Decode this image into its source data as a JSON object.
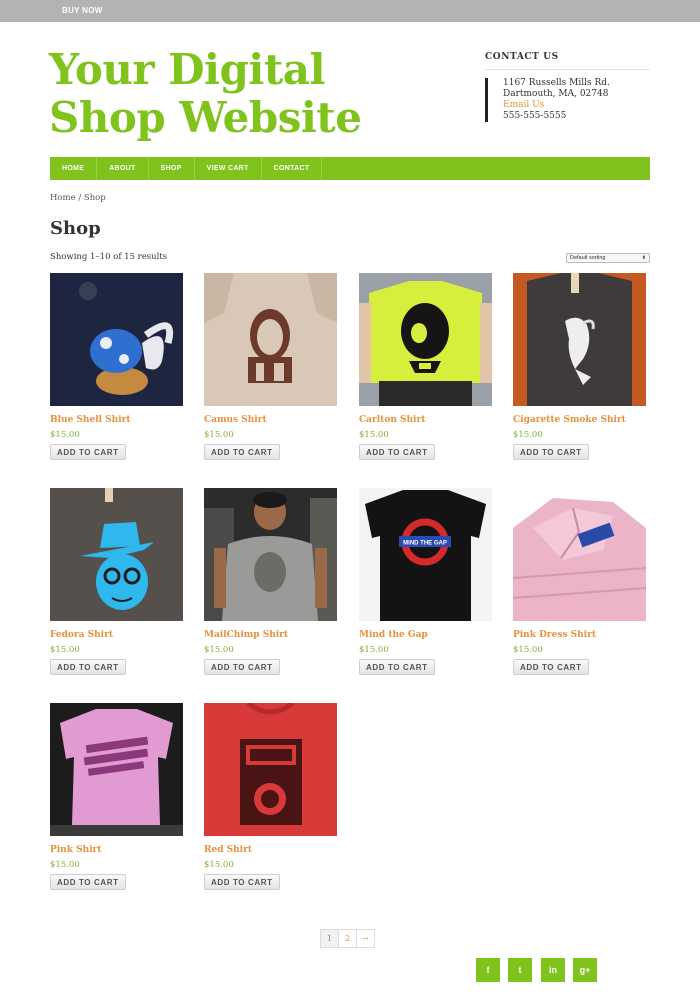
{
  "topbar": {
    "buy_now": "BUY NOW"
  },
  "site": {
    "title": "Your Digital Shop Website"
  },
  "contact": {
    "heading": "CONTACT US",
    "address1": "1167 Russells Mills Rd.",
    "address2": "Dartmouth, MA, 02748",
    "email_label": "Email Us",
    "phone": "555-555-5555"
  },
  "nav": [
    "HOME",
    "ABOUT",
    "SHOP",
    "VIEW CART",
    "CONTACT"
  ],
  "breadcrumb": "Home / Shop",
  "page": {
    "title": "Shop",
    "result_count": "Showing 1–10 of 15 results",
    "sort_selected": "Default sorting"
  },
  "products": [
    {
      "name": "Blue Shell Shirt",
      "price": "$15.00",
      "button": "ADD TO CART"
    },
    {
      "name": "Camus Shirt",
      "price": "$15.00",
      "button": "ADD TO CART"
    },
    {
      "name": "Carlton Shirt",
      "price": "$15.00",
      "button": "ADD TO CART"
    },
    {
      "name": "Cigarette Smoke Shirt",
      "price": "$15.00",
      "button": "ADD TO CART"
    },
    {
      "name": "Fedora Shirt",
      "price": "$15.00",
      "button": "ADD TO CART"
    },
    {
      "name": "MailChimp Shirt",
      "price": "$15.00",
      "button": "ADD TO CART"
    },
    {
      "name": "Mind the Gap",
      "price": "$15.00",
      "button": "ADD TO CART"
    },
    {
      "name": "Pink Dress Shirt",
      "price": "$15.00",
      "button": "ADD TO CART"
    },
    {
      "name": "Pink Shirt",
      "price": "$15.00",
      "button": "ADD TO CART"
    },
    {
      "name": "Red Shirt",
      "price": "$15.00",
      "button": "ADD TO CART"
    }
  ],
  "pagination": {
    "current": "1",
    "next_page": "2",
    "next_arrow": "→"
  },
  "social": {
    "facebook": "f",
    "twitter": "t",
    "linkedin": "in",
    "googleplus": "g+"
  },
  "colors": {
    "brand_green": "#7fc31c",
    "link_orange": "#e8913a",
    "price_green": "#7fae3a"
  }
}
